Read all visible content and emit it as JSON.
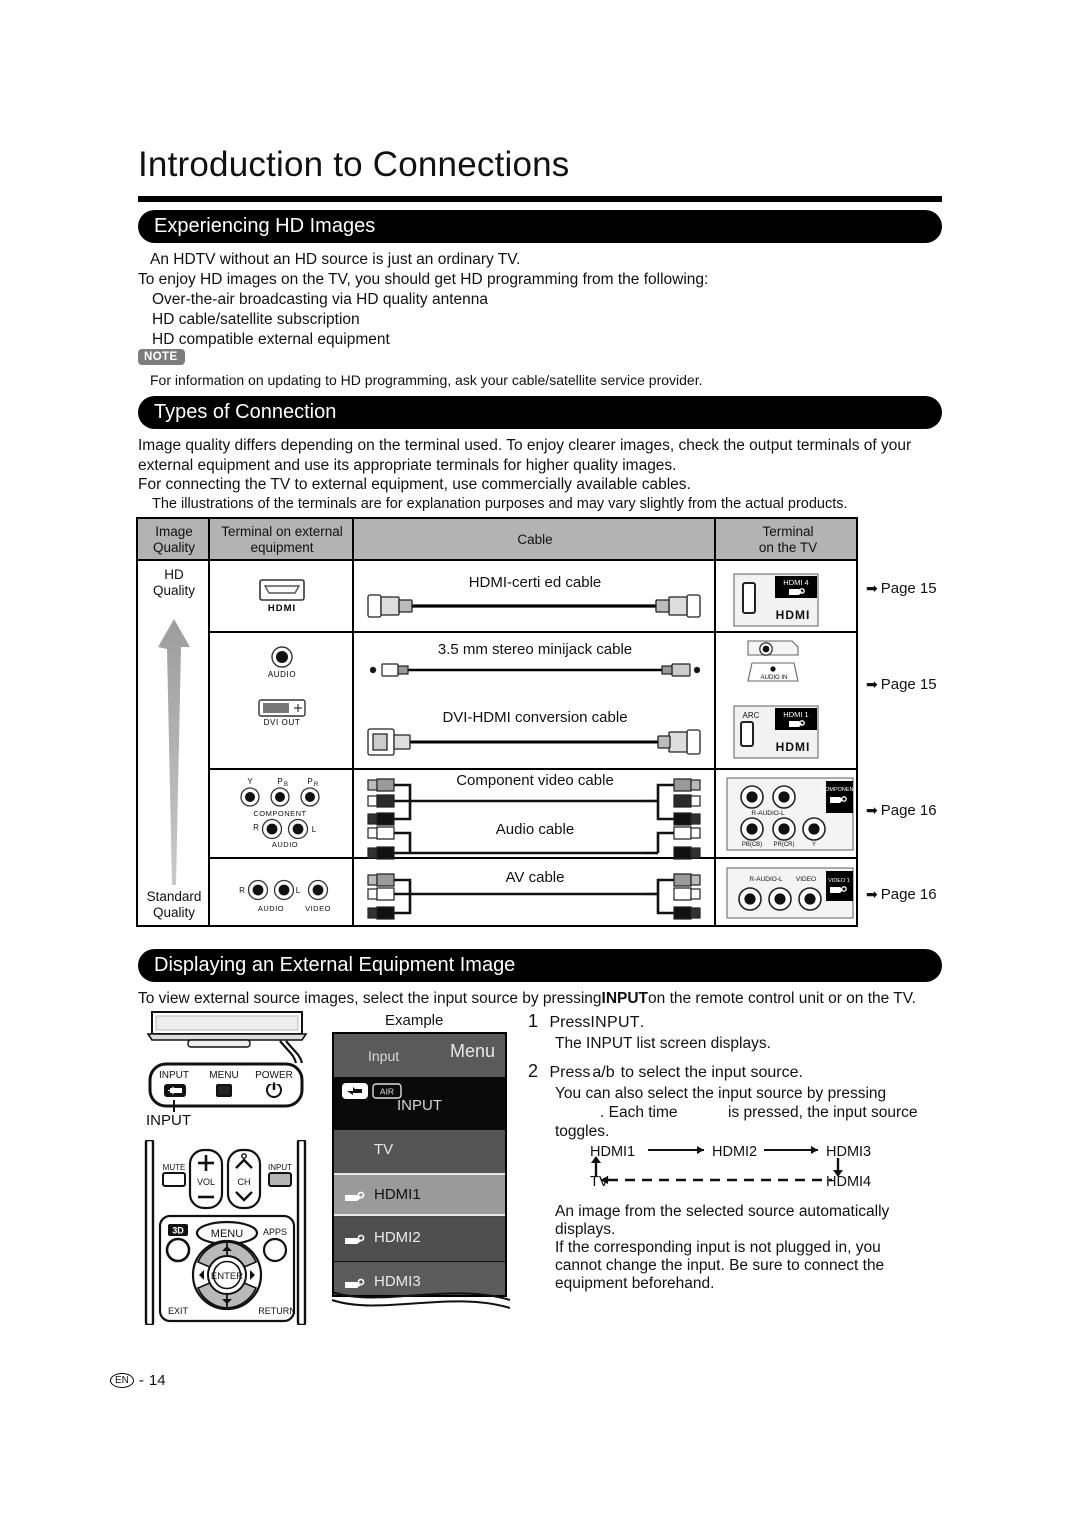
{
  "page": {
    "title": "Introduction to Connections",
    "footer_lang": "EN",
    "footer_sep": "-",
    "footer_page": "14"
  },
  "section_hd": {
    "heading": "Experiencing HD Images",
    "line1": "An HDTV without an HD source is just an ordinary TV.",
    "line2": "To enjoy HD images on the TV, you should get HD programming from the following:",
    "bullet1": "Over-the-air broadcasting via HD quality antenna",
    "bullet2": "HD cable/satellite subscription",
    "bullet3": "HD compatible external equipment",
    "note_badge": "NOTE",
    "note_text": "For information on updating to HD programming, ask your cable/satellite service provider."
  },
  "section_types": {
    "heading": "Types of Connection",
    "para1": "Image quality differs depending on the terminal used. To enjoy clearer images, check the output terminals of your",
    "para2": "external equipment and use its appropriate terminals for higher quality images.",
    "para3": "For connecting the TV to external equipment, use commercially available cables.",
    "para4": "The illustrations of the terminals are for explanation purposes and may vary slightly from the actual products."
  },
  "table": {
    "headers": {
      "quality": "Image\nQuality",
      "external": "Terminal on external\nequipment",
      "cable": "Cable",
      "tv": "Terminal\non the TV"
    },
    "quality_top": "HD\nQuality",
    "quality_bottom": "Standard\nQuality",
    "rows": [
      {
        "external_labels": [
          "HDMI"
        ],
        "cables": [
          "HDMI-certi ed cable"
        ],
        "tv_labels": [
          "HDMI 4",
          "HDMI"
        ],
        "page_ref": "Page 15"
      },
      {
        "external_labels": [
          "AUDIO",
          "DVI OUT"
        ],
        "cables": [
          "3.5 mm stereo minijack cable",
          "DVI-HDMI conversion cable"
        ],
        "tv_labels": [
          "AUDIO IN",
          "ARC",
          "HDMI 1",
          "HDMI"
        ],
        "page_ref": "Page 15"
      },
      {
        "external_labels": [
          "Y",
          "PB",
          "PR",
          "COMPONENT",
          "R",
          "L",
          "AUDIO"
        ],
        "cables": [
          "Component video cable",
          "Audio cable"
        ],
        "tv_labels": [
          "R-AUDIO-L",
          "PB(CB)",
          "PR(CR)",
          "Y",
          "COMPONENT"
        ],
        "page_ref": "Page 16"
      },
      {
        "external_labels": [
          "R",
          "L",
          "AUDIO",
          "VIDEO"
        ],
        "cables": [
          "AV cable"
        ],
        "tv_labels": [
          "R-AUDIO-L",
          "VIDEO",
          "VIDEO 1"
        ],
        "page_ref": "Page 16"
      }
    ],
    "page_arrow": "➡"
  },
  "section_display": {
    "heading": "Displaying an External Equipment Image",
    "intro": "To view external source images, select the input source by pressing",
    "intro_bold": "INPUT",
    "intro_rest": "on the remote control unit or on the TV.",
    "step1_num": "1",
    "step1_a": "Press",
    "step1_b": "INPUT",
    "step1_c": ".",
    "step1_sub": "The INPUT list screen displays.",
    "step2_num": "2",
    "step2_a": "Press",
    "step2_b": "a",
    "step2_slash": "/",
    "step2_c": "b",
    "step2_d": "to select the input source.",
    "step2_sub1": "You can also select the input source by pressing",
    "step2_sub2": ". Each time",
    "step2_sub3": "is pressed, the input source",
    "step2_sub4": "toggles.",
    "toggle": {
      "hdmi1": "HDMI1",
      "hdmi2": "HDMI2",
      "hdmi3": "HDMI3",
      "hdmi4": "HDMI4",
      "tv": "TV"
    },
    "result1": "An image from the selected source automatically",
    "result2": "displays.",
    "result3": "If the corresponding input is not plugged in, you",
    "result4": "cannot change the input. Be sure to connect the",
    "result5": "equipment beforehand."
  },
  "tv_panel": {
    "input": "INPUT",
    "menu": "MENU",
    "power": "POWER",
    "callout": "INPUT"
  },
  "remote": {
    "mute": "MUTE",
    "vol": "VOL",
    "ch": "CH",
    "input": "INPUT",
    "menu": "MENU",
    "apps": "APPS",
    "threeD": "3D",
    "enter": "ENTER",
    "exit": "EXIT",
    "return": "RETURN"
  },
  "osd": {
    "example_label": "Example",
    "input_label": "Input",
    "menu_label": "Menu",
    "air_label": "AIR",
    "input_title": "INPUT",
    "items": [
      {
        "label": "TV",
        "selected": false,
        "has_icon": false
      },
      {
        "label": "HDMI1",
        "selected": true,
        "has_icon": true
      },
      {
        "label": "HDMI2",
        "selected": false,
        "has_icon": true
      },
      {
        "label": "HDMI3",
        "selected": false,
        "has_icon": true
      }
    ]
  },
  "colors": {
    "bar_bg": "#000000",
    "bar_fg": "#ffffff",
    "table_header_bg": "#b3b3b3",
    "note_bg": "#7d7d7d",
    "arrow_gray": "#8f8f8f",
    "osd_bg": "#4a4a4a",
    "osd_selected": "#9a9a9a"
  }
}
